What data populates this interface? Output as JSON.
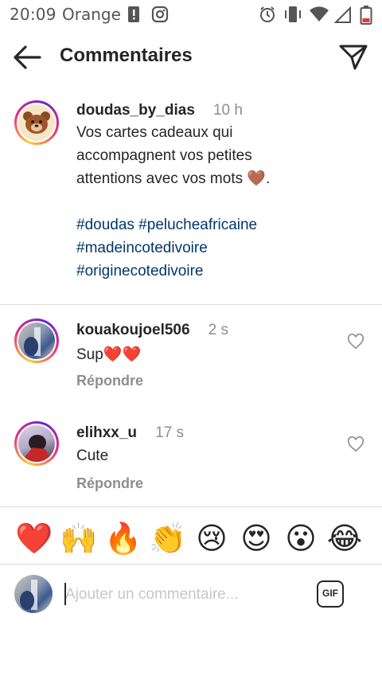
{
  "status_bar": {
    "time": "20:09",
    "carrier": "Orange",
    "icons": [
      "sim-alert-icon",
      "instagram-icon",
      "alarm-icon",
      "vibrate-icon",
      "wifi-icon",
      "signal-icon",
      "battery-icon"
    ]
  },
  "header": {
    "title": "Commentaires",
    "back_icon": "arrow-left-icon",
    "share_icon": "paper-plane-icon"
  },
  "caption": {
    "username": "doudas_by_dias",
    "time": "10 h",
    "lines": [
      "Vos cartes cadeaux qui",
      "accompagnent vos petites",
      "attentions avec vos mots 🤎."
    ],
    "hashtags": [
      "#doudas #pelucheafricaine",
      "#madeincotedivoire",
      "#originecotedivoire"
    ]
  },
  "comments": [
    {
      "username": "kouakoujoel506",
      "time": "2 s",
      "text": "Sup❤️❤️",
      "reply_label": "Répondre"
    },
    {
      "username": "elihxx_u",
      "time": "17 s",
      "text": "Cute",
      "reply_label": "Répondre"
    }
  ],
  "emoji_bar": [
    "❤️",
    "🙌",
    "🔥",
    "👏",
    "😢",
    "😍",
    "😮",
    "😂"
  ],
  "composer": {
    "placeholder": "Ajouter un commentaire...",
    "gif_label": "GIF"
  },
  "colors": {
    "hashtag": "#00376b",
    "muted": "#8e8e8e",
    "text": "#262626",
    "divider": "#dbdbdb"
  }
}
